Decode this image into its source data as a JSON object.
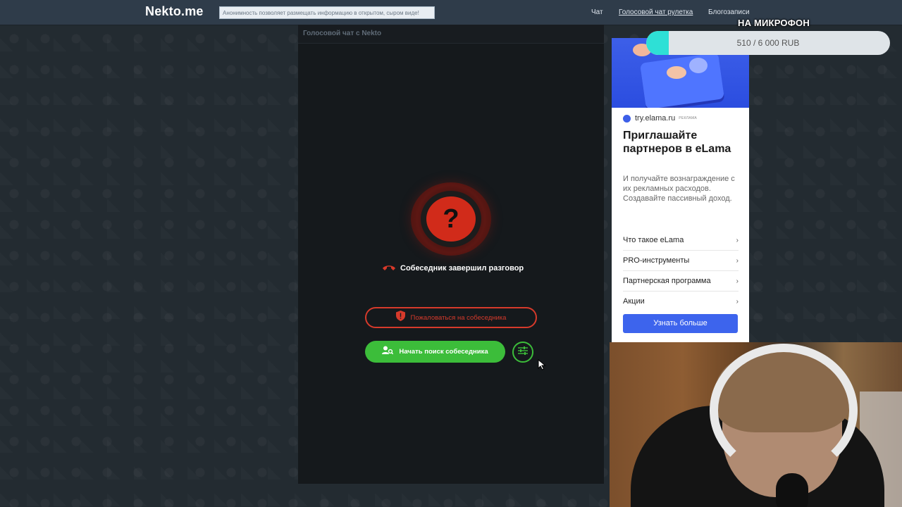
{
  "header": {
    "logo": "Nekto.me",
    "notice": "Анонимность позволяет размещать информацию в открытом, сыром виде!",
    "nav": [
      {
        "label": "Чат"
      },
      {
        "label": "Голосовой чат рулетка"
      },
      {
        "label": "Блогозаписи"
      }
    ]
  },
  "chat": {
    "title": "Голосовой чат с Nekto",
    "status": "Собеседник завершил разговор",
    "unknown_symbol": "?",
    "complain_label": "Пожаловаться на собеседника",
    "search_label": "Начать поиск собеседника"
  },
  "ad": {
    "domain": "try.elama.ru",
    "ad_label": "РЕКЛАМА",
    "title": "Приглашайте партнеров в eLama",
    "description": "И получайте вознаграждение с их рекламных расходов. Создавайте пассивный доход.",
    "links": [
      {
        "label": "Что такое eLama"
      },
      {
        "label": "PRO-инструменты"
      },
      {
        "label": "Партнерская программа"
      },
      {
        "label": "Акции"
      }
    ],
    "cta": "Узнать больше"
  },
  "donation": {
    "title": "НА МИКРОФОН",
    "amount_text": "510 / 6 000 RUB",
    "current": 510,
    "goal": 6000
  },
  "colors": {
    "accent_green": "#3cbd3a",
    "accent_red": "#d12b1a",
    "ad_blue": "#3d64ed",
    "donation_fill": "#2ee0d6"
  }
}
